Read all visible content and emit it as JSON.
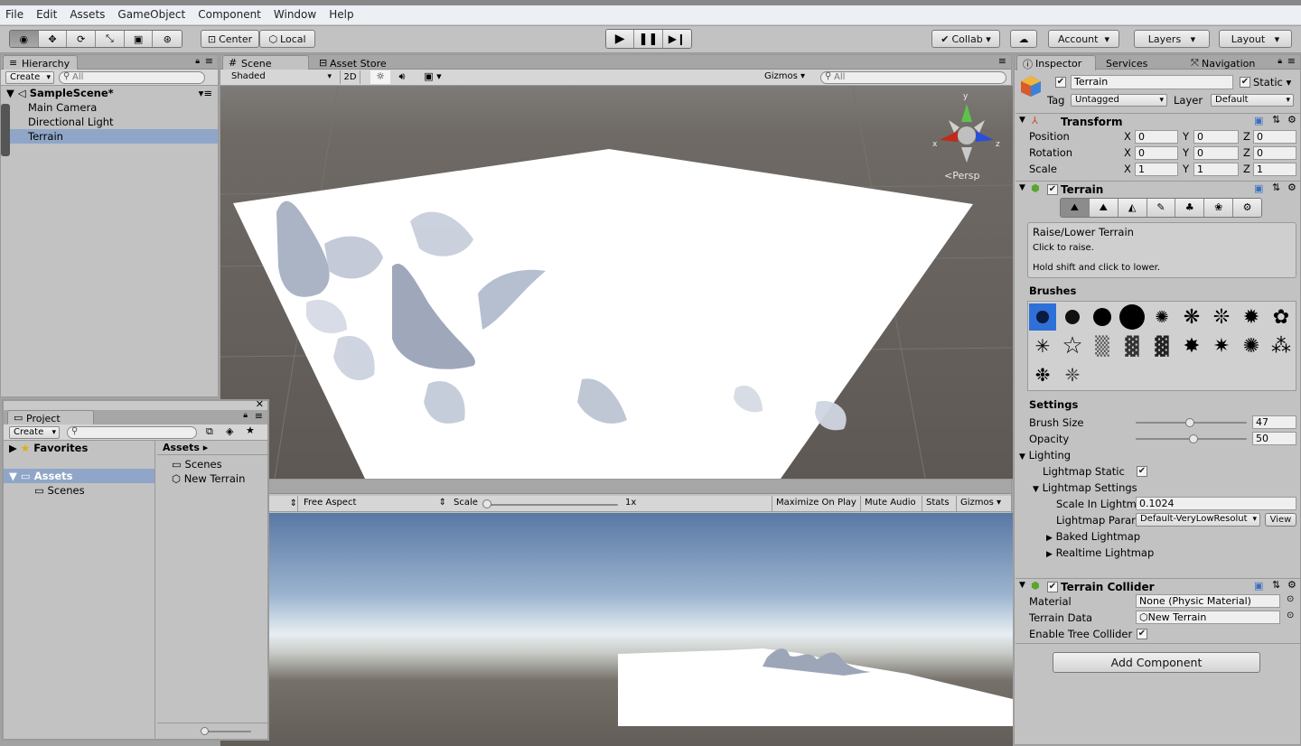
{
  "menu": [
    "File",
    "Edit",
    "Assets",
    "GameObject",
    "Component",
    "Window",
    "Help"
  ],
  "toolbar": {
    "pivot": "Center",
    "space": "Local",
    "collab": "Collab",
    "account": "Account",
    "layers": "Layers",
    "layout": "Layout"
  },
  "hierarchy": {
    "tab": "Hierarchy",
    "create": "Create",
    "search_placeholder": "All",
    "scene": "SampleScene*",
    "items": [
      "Main Camera",
      "Directional Light",
      "Terrain"
    ],
    "selected": "Terrain"
  },
  "scene_view": {
    "tab": "Scene",
    "tab2": "Asset Store",
    "shading": "Shaded",
    "mode_2d": "2D",
    "gizmos": "Gizmos",
    "search_placeholder": "All",
    "persp": "Persp",
    "axes": {
      "x": "x",
      "y": "y",
      "z": "z"
    }
  },
  "game_view": {
    "aspect": "Free Aspect",
    "scale_label": "Scale",
    "scale_value": "1x",
    "maximize": "Maximize On Play",
    "mute": "Mute Audio",
    "stats": "Stats",
    "gizmos": "Gizmos"
  },
  "project": {
    "tab": "Project",
    "create": "Create",
    "favorites": "Favorites",
    "assets": "Assets",
    "tree_scenes": "Scenes",
    "breadcrumb": "Assets",
    "items": [
      "Scenes",
      "New Terrain"
    ]
  },
  "inspector": {
    "tabs": [
      "Inspector",
      "Services",
      "Navigation"
    ],
    "object_name": "Terrain",
    "static_label": "Static",
    "tag_label": "Tag",
    "tag_value": "Untagged",
    "layer_label": "Layer",
    "layer_value": "Default",
    "transform": {
      "title": "Transform",
      "rows": [
        {
          "label": "Position",
          "x": "0",
          "y": "0",
          "z": "0"
        },
        {
          "label": "Rotation",
          "x": "0",
          "y": "0",
          "z": "0"
        },
        {
          "label": "Scale",
          "x": "1",
          "y": "1",
          "z": "1"
        }
      ]
    },
    "terrain": {
      "title": "Terrain",
      "tool_title": "Raise/Lower Terrain",
      "tool_desc1": "Click to raise.",
      "tool_desc2": "Hold shift and click to lower.",
      "brushes_label": "Brushes",
      "settings_label": "Settings",
      "brush_size_label": "Brush Size",
      "brush_size_value": "47",
      "brush_size_fraction": 0.47,
      "opacity_label": "Opacity",
      "opacity_value": "50",
      "opacity_fraction": 0.5,
      "lighting_label": "Lighting",
      "lightmap_static_label": "Lightmap Static",
      "lightmap_settings_label": "Lightmap Settings",
      "scale_in_lightmap_label": "Scale In Lightm",
      "scale_in_lightmap_value": "0.1024",
      "lightmap_param_label": "Lightmap Parar",
      "lightmap_param_value": "Default-VeryLowResolut",
      "view_button": "View",
      "baked_label": "Baked Lightmap",
      "realtime_label": "Realtime Lightmap"
    },
    "collider": {
      "title": "Terrain Collider",
      "material_label": "Material",
      "material_value": "None (Physic Material)",
      "data_label": "Terrain Data",
      "data_value": "New Terrain",
      "tree_label": "Enable Tree Collider"
    },
    "add_component": "Add Component"
  },
  "colors": {
    "panel_bg": "#c2c2c2",
    "selection": "#8fa6c8",
    "scene_ground": "#64605c",
    "sky_top": "#5a7aa6"
  }
}
